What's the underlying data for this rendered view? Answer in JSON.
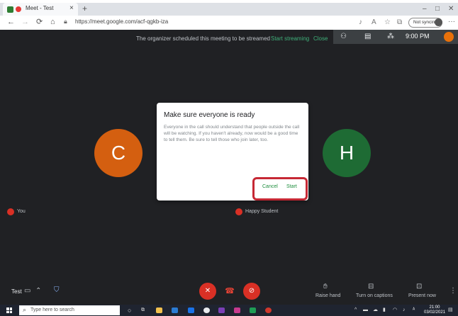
{
  "browser": {
    "tab_title": "Meet - Test",
    "tab_close": "×",
    "new_tab": "+",
    "minimize": "–",
    "maximize": "□",
    "close": "✕",
    "back": "←",
    "forward": "→",
    "reload": "⟳",
    "home": "⌂",
    "url": "https://meet.google.com/acf-qgkb-iza",
    "not_syncing": "Not syncing",
    "more": "···"
  },
  "meet": {
    "banner_text": "The organizer scheduled this meeting to be streamed",
    "start_streaming": "Start streaming",
    "close_banner": "Close",
    "clock": "9:00 PM",
    "participants": [
      {
        "initial": "C",
        "name": "You",
        "color": "#d45f10"
      },
      {
        "initial": "H",
        "name": "Happy Student",
        "color": "#1e6b34"
      }
    ],
    "dialog": {
      "title": "Make sure everyone is ready",
      "body": "Everyone in the call should understand that people outside the call will be watching. If you haven't already, now would be a good time to tell them. Be sure to tell those who join later, too.",
      "cancel": "Cancel",
      "start": "Start"
    },
    "controls": {
      "meeting_name": "Test",
      "raise_hand": "Raise hand",
      "captions": "Turn on captions",
      "present": "Present now",
      "more": "⋮"
    }
  },
  "taskbar": {
    "search_placeholder": "Type here to search",
    "time": "21:00",
    "date": "03/02/2021"
  },
  "colors": {
    "accent_green": "#1e8e3e",
    "stream_green": "#3fb07a",
    "mute_red": "#d93025",
    "highlight_red": "#c62834"
  }
}
